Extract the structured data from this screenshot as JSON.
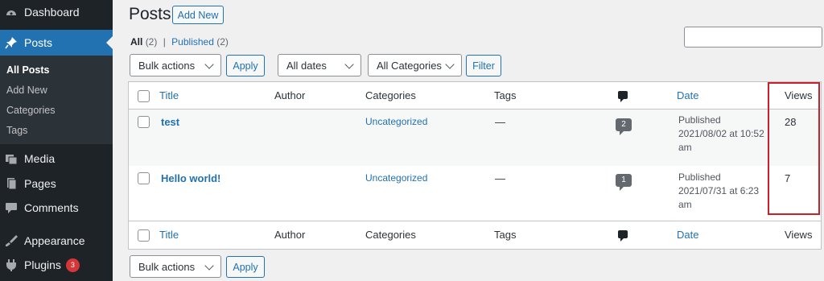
{
  "sidebar": {
    "items": [
      {
        "label": "Dashboard",
        "icon": "dashboard-icon"
      },
      {
        "label": "Posts",
        "icon": "pin-icon"
      },
      {
        "label": "Media",
        "icon": "media-icon"
      },
      {
        "label": "Pages",
        "icon": "pages-icon"
      },
      {
        "label": "Comments",
        "icon": "comments-icon"
      },
      {
        "label": "Appearance",
        "icon": "appearance-icon"
      },
      {
        "label": "Plugins",
        "icon": "plugins-icon",
        "badge": "3"
      }
    ],
    "submenu": [
      "All Posts",
      "Add New",
      "Categories",
      "Tags"
    ]
  },
  "header": {
    "title": "Posts",
    "add_new": "Add New"
  },
  "filters": {
    "all_label": "All",
    "all_count": "(2)",
    "separator": "|",
    "published_label": "Published",
    "published_count": "(2)",
    "bulk_actions": "Bulk actions",
    "apply": "Apply",
    "dates": "All dates",
    "categories": "All Categories",
    "filter": "Filter"
  },
  "table": {
    "columns": {
      "title": "Title",
      "author": "Author",
      "categories": "Categories",
      "tags": "Tags",
      "date": "Date",
      "views": "Views"
    },
    "rows": [
      {
        "title": "test",
        "category": "Uncategorized",
        "tags": "—",
        "comments": "2",
        "date_status": "Published",
        "date_line": "2021/08/02 at 10:52",
        "date_ampm": "am",
        "views": "28"
      },
      {
        "title": "Hello world!",
        "category": "Uncategorized",
        "tags": "—",
        "comments": "1",
        "date_status": "Published",
        "date_line": "2021/07/31 at 6:23",
        "date_ampm": "am",
        "views": "7"
      }
    ]
  },
  "bottom": {
    "bulk_actions": "Bulk actions",
    "apply": "Apply"
  },
  "colors": {
    "accent": "#2271b1",
    "sidebar_bg": "#1d2327",
    "highlight": "#cc1f2a",
    "badge": "#d63638"
  }
}
